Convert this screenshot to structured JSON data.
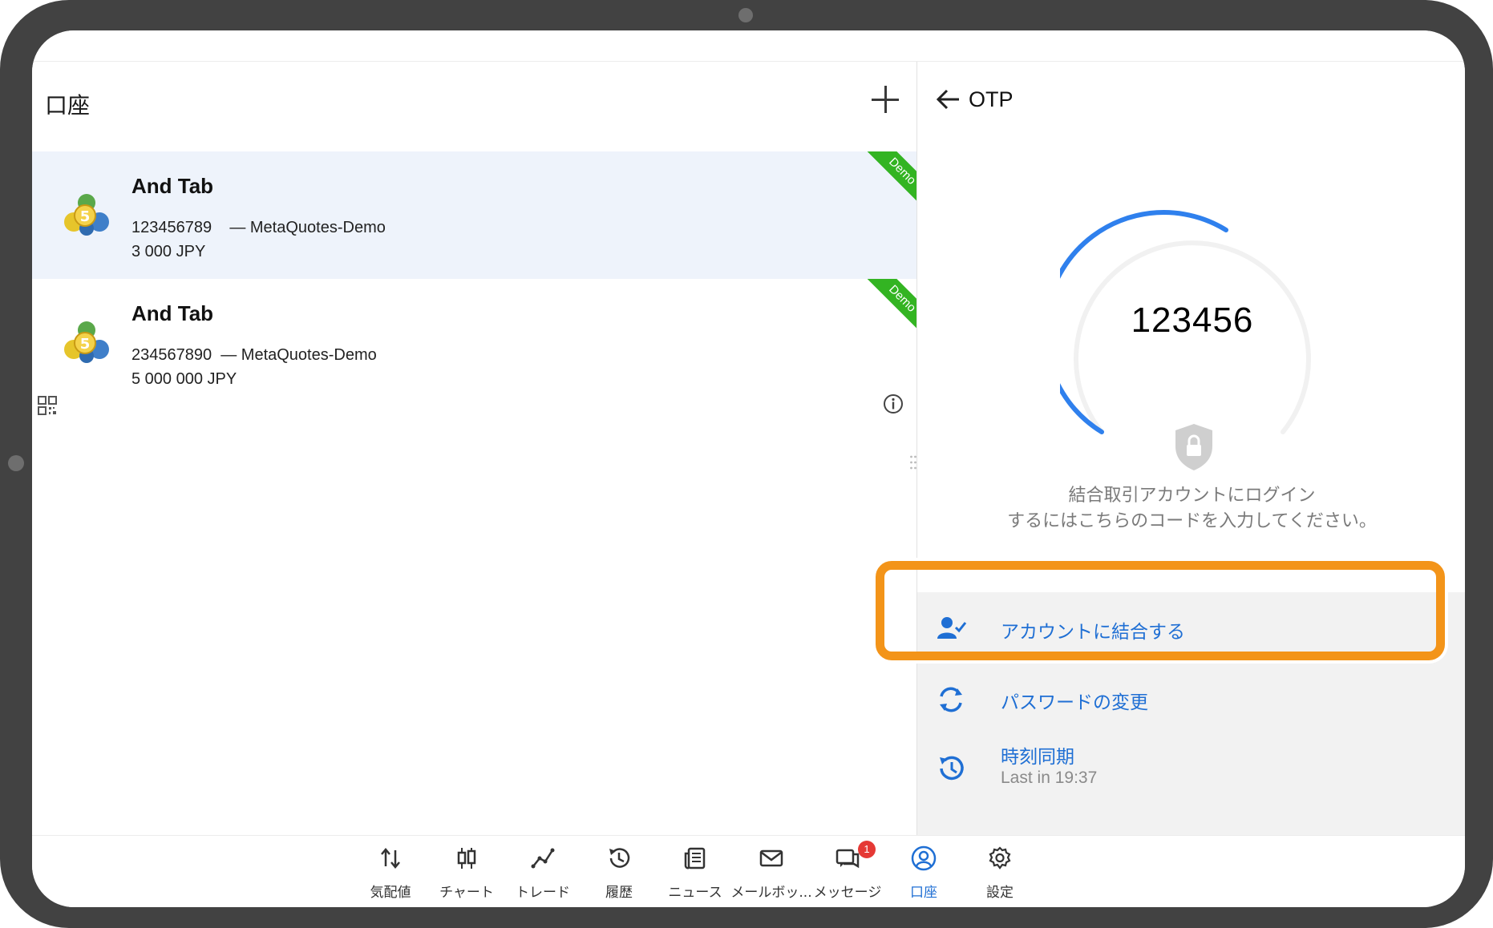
{
  "left_pane": {
    "title": "口座",
    "accounts": [
      {
        "name": "And Tab",
        "number": "123456789",
        "server": "— MetaQuotes-Demo",
        "balance": "3 000 JPY",
        "ribbon": "Demo",
        "selected": true
      },
      {
        "name": "And Tab",
        "number": "234567890",
        "server": "— MetaQuotes-Demo",
        "balance": "5 000 000 JPY",
        "ribbon": "Demo",
        "selected": false
      }
    ]
  },
  "right_pane": {
    "title": "OTP",
    "otp_code": "123456",
    "description_line1": "結合取引アカウントにログイン",
    "description_line2": "するにはこちらのコードを入力してください。",
    "actions": [
      {
        "label": "アカウントに結合する",
        "icon": "link-account-icon"
      },
      {
        "label": "パスワードの変更",
        "icon": "change-password-icon"
      },
      {
        "label": "時刻同期",
        "sublabel": "Last in 19:37",
        "icon": "time-sync-icon"
      }
    ]
  },
  "bottom_nav": {
    "items": [
      {
        "label": "気配値",
        "icon": "quotes-icon"
      },
      {
        "label": "チャート",
        "icon": "chart-icon"
      },
      {
        "label": "トレード",
        "icon": "trade-icon"
      },
      {
        "label": "履歴",
        "icon": "history-icon"
      },
      {
        "label": "ニュース",
        "icon": "news-icon"
      },
      {
        "label": "メールボッ...",
        "icon": "mail-icon"
      },
      {
        "label": "メッセージ",
        "icon": "messages-icon",
        "badge": "1"
      },
      {
        "label": "口座",
        "icon": "account-icon",
        "active": true
      },
      {
        "label": "設定",
        "icon": "settings-icon"
      }
    ]
  },
  "colors": {
    "accent": "#1f6fd4",
    "highlight": "#f39419",
    "ribbon": "#33b422",
    "frame": "#424242",
    "selected_row": "#eef3fb"
  }
}
